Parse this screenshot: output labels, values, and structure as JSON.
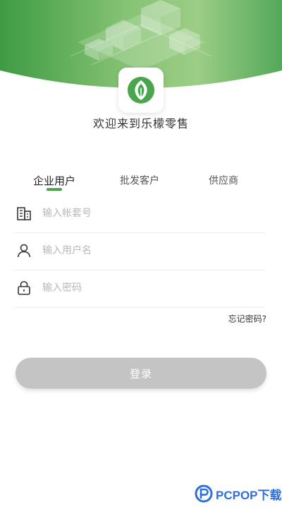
{
  "header": {
    "welcome_text": "欢迎来到乐檬零售"
  },
  "tabs": [
    {
      "label": "企业用户",
      "active": true
    },
    {
      "label": "批发客户",
      "active": false
    },
    {
      "label": "供应商",
      "active": false
    }
  ],
  "form": {
    "account_placeholder": "输入帐套号",
    "username_placeholder": "输入用户名",
    "password_placeholder": "输入密码",
    "forgot_password": "忘记密码?",
    "login_label": "登录"
  },
  "watermark": {
    "text": "PCPOP下载"
  },
  "colors": {
    "accent_green": "#4aa64c",
    "button_disabled": "#c4c4c4",
    "watermark_blue": "#2e6fd8"
  },
  "icons": {
    "account": "building-icon",
    "user": "user-icon",
    "password": "lock-icon"
  }
}
